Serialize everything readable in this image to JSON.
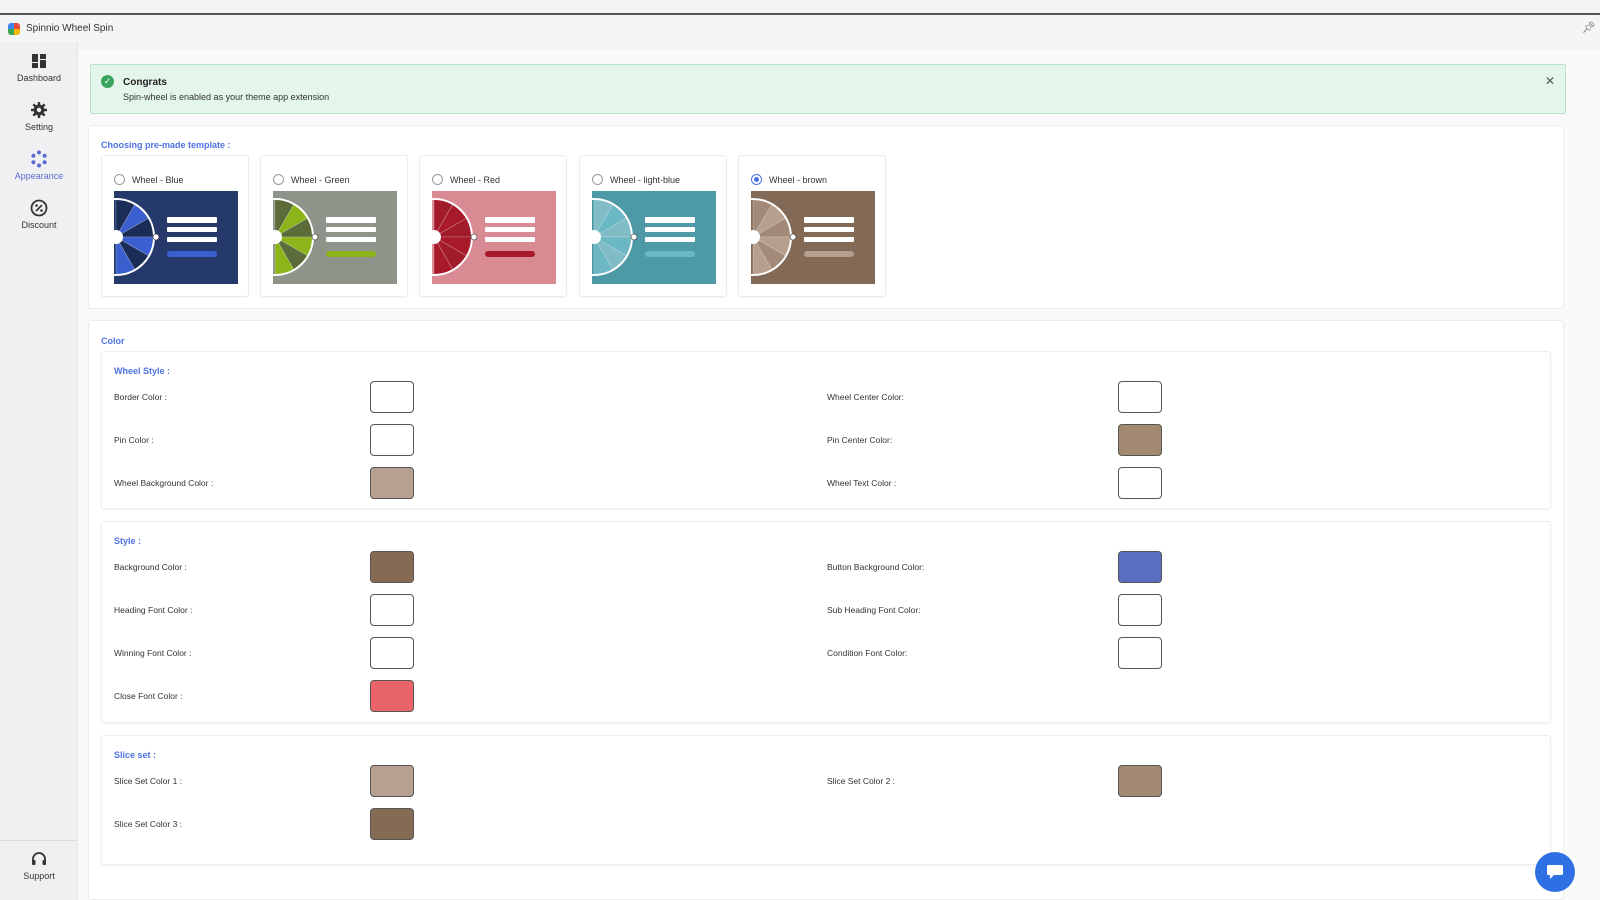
{
  "app": {
    "title": "Spinnio Wheel Spin",
    "pin_icon": "pin-icon"
  },
  "sidebar": {
    "items": [
      {
        "label": "Dashboard",
        "icon": "dashboard-icon"
      },
      {
        "label": "Setting",
        "icon": "gear-icon"
      },
      {
        "label": "Appearance",
        "icon": "appearance-icon",
        "active": true
      },
      {
        "label": "Discount",
        "icon": "discount-icon"
      }
    ],
    "support": {
      "label": "Support",
      "icon": "headset-icon"
    }
  },
  "alert": {
    "title": "Congrats",
    "message": "Spin-wheel is enabled as your theme app extension",
    "icon": "check-circle-icon",
    "close_icon": "close-icon"
  },
  "templates": {
    "heading": "Choosing pre-made template :",
    "items": [
      {
        "name": "Wheel - Blue",
        "selected": false,
        "bg": "#253a6b",
        "accent": "#3b5fcf",
        "dark": "#1a2d57"
      },
      {
        "name": "Wheel - Green",
        "selected": false,
        "bg": "#8e9489",
        "accent": "#8db51b",
        "dark": "#5b6b3a"
      },
      {
        "name": "Wheel - Red",
        "selected": false,
        "bg": "#d98b93",
        "accent": "#a8192a",
        "dark": "#a11b2d"
      },
      {
        "name": "Wheel - light-blue",
        "selected": false,
        "bg": "#4e99a6",
        "accent": "#6bb8c4",
        "dark": "#7fbcc6"
      },
      {
        "name": "Wheel - brown",
        "selected": true,
        "bg": "#836a56",
        "accent": "#b69f8e",
        "dark": "#a38a78"
      }
    ]
  },
  "color": {
    "heading": "Color",
    "wheel_style": {
      "title": "Wheel Style :",
      "rows": [
        {
          "label": "Border Color :",
          "color": "#ffffff"
        },
        {
          "label": "Wheel Center Color:",
          "color": "#ffffff"
        },
        {
          "label": "Pin Color :",
          "color": "#ffffff"
        },
        {
          "label": "Pin Center Color:",
          "color": "#a38a72"
        },
        {
          "label": "Wheel Background Color :",
          "color": "#b8a090"
        },
        {
          "label": "Wheel Text Color :",
          "color": "#ffffff"
        }
      ]
    },
    "style": {
      "title": "Style :",
      "rows": [
        {
          "label": "Background Color :",
          "color": "#856b54"
        },
        {
          "label": "Button Background Color:",
          "color": "#5a6ec2"
        },
        {
          "label": "Heading Font Color :",
          "color": "#ffffff"
        },
        {
          "label": "Sub Heading Font Color:",
          "color": "#ffffff"
        },
        {
          "label": "Winning Font Color :",
          "color": "#ffffff"
        },
        {
          "label": "Condition Font Color:",
          "color": "#ffffff"
        },
        {
          "label": "Close Font Color :",
          "color": "#e8646a"
        }
      ]
    },
    "slice_set": {
      "title": "Slice set :",
      "rows": [
        {
          "label": "Slice Set Color 1 :",
          "color": "#b8a090"
        },
        {
          "label": "Slice Set Color 2 :",
          "color": "#a38a72"
        },
        {
          "label": "Slice Set Color 3 :",
          "color": "#856b54"
        }
      ]
    }
  },
  "chat": {
    "icon": "chat-icon"
  }
}
